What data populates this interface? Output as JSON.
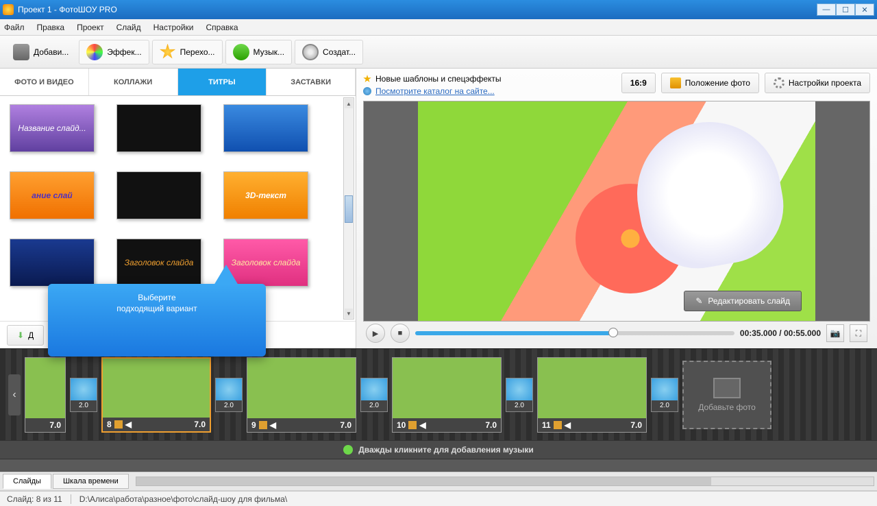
{
  "window": {
    "title": "Проект 1 - ФотоШОУ PRO"
  },
  "menu": {
    "file": "Файл",
    "edit": "Правка",
    "project": "Проект",
    "slide": "Слайд",
    "settings": "Настройки",
    "help": "Справка"
  },
  "toolbar": {
    "add": "Добави...",
    "effects": "Эффек...",
    "transitions": "Перехо...",
    "music": "Музык...",
    "create": "Создат..."
  },
  "tabs": {
    "photo": "ФОТО И ВИДЕО",
    "collage": "КОЛЛАЖИ",
    "titles": "ТИТРЫ",
    "intro": "ЗАСТАВКИ"
  },
  "gallery": {
    "items": [
      {
        "label": "Название слайд..."
      },
      {
        "label": ""
      },
      {
        "label": ""
      },
      {
        "label": "ание слай"
      },
      {
        "label": ""
      },
      {
        "label": "3D-текст"
      },
      {
        "label": ""
      },
      {
        "label": "Заголовок слайда"
      },
      {
        "label": "Заголовок слайда"
      }
    ],
    "add_button": "Д"
  },
  "callout": {
    "line1": "Выберите",
    "line2": "подходящий вариант"
  },
  "info": {
    "templates": "Новые шаблоны и спецэффекты",
    "catalog": "Посмотрите каталог на сайте...",
    "ratio": "16:9",
    "position": "Положение фото",
    "settings": "Настройки проекта"
  },
  "preview": {
    "edit_btn": "Редактировать слайд"
  },
  "playbar": {
    "time_current": "00:35.000",
    "time_total": "00:55.000"
  },
  "timeline": {
    "slides": [
      {
        "num": "",
        "dur": "7.0",
        "trans": "2.0",
        "cls": "si-baby"
      },
      {
        "num": "8",
        "dur": "7.0",
        "trans": "2.0",
        "cls": "si-bfly",
        "selected": true
      },
      {
        "num": "9",
        "dur": "7.0",
        "trans": "2.0",
        "cls": "si-kitten"
      },
      {
        "num": "10",
        "dur": "7.0",
        "trans": "2.0",
        "cls": "si-flowers"
      },
      {
        "num": "11",
        "dur": "7.0",
        "trans": "2.0",
        "cls": "si-dog"
      }
    ],
    "add_photo": "Добавьте фото",
    "music_hint": "Дважды кликните для добавления музыки"
  },
  "viewtabs": {
    "slides": "Слайды",
    "timeline": "Шкала времени"
  },
  "status": {
    "slide": "Слайд: 8 из 11",
    "path": "D:\\Алиса\\работа\\разное\\фото\\слайд-шоу для фильма\\"
  }
}
